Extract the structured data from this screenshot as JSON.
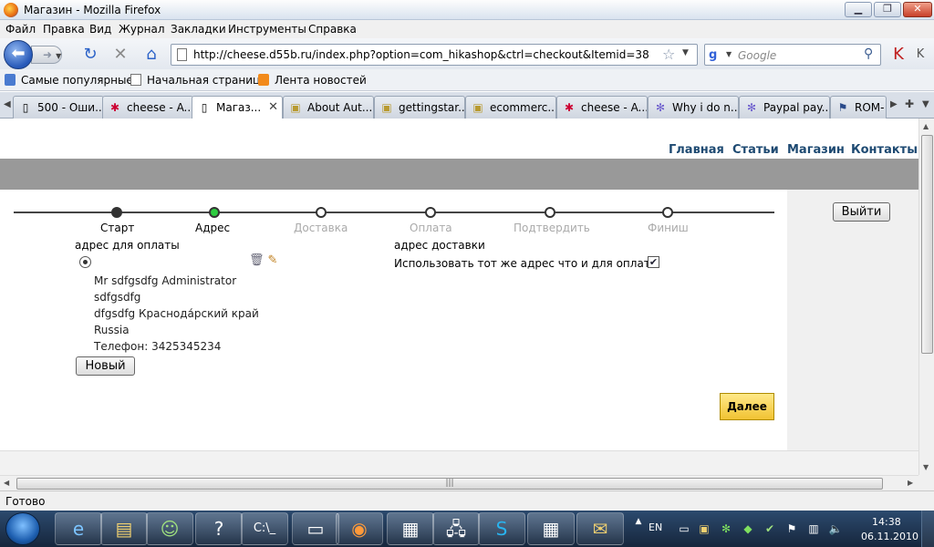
{
  "window": {
    "title": "Магазин - Mozilla Firefox",
    "minimize_icon": "minimize-icon",
    "maximize_icon": "restore-icon",
    "close_icon": "close-icon"
  },
  "menu": [
    "Файл",
    "Правка",
    "Вид",
    "Журнал",
    "Закладки",
    "Инструменты",
    "Справка"
  ],
  "nav": {
    "url": "http://cheese.d55b.ru/index.php?option=com_hikashop&ctrl=checkout&Itemid=38",
    "search_placeholder": "Google"
  },
  "bookmarks": [
    "Самые популярные",
    "Начальная страница",
    "Лента новостей"
  ],
  "tabs": [
    {
      "label": "500 - Оши...",
      "icon": "page-icon",
      "active": false
    },
    {
      "label": "cheese - A...",
      "icon": "joomla-icon",
      "active": false
    },
    {
      "label": "Магаз...",
      "icon": "page-icon",
      "active": true
    },
    {
      "label": "About Aut...",
      "icon": "folder-icon",
      "active": false
    },
    {
      "label": "gettingstar...",
      "icon": "folder-icon",
      "active": false
    },
    {
      "label": "ecommerc...",
      "icon": "folder-icon",
      "active": false
    },
    {
      "label": "cheese - A...",
      "icon": "joomla-icon",
      "active": false
    },
    {
      "label": "Why i do n...",
      "icon": "gear-icon",
      "active": false
    },
    {
      "label": "Paypal pay...",
      "icon": "gear-icon",
      "active": false
    },
    {
      "label": "ROM-",
      "icon": "flag-icon",
      "active": false
    }
  ],
  "site_nav": [
    "Главная",
    "Статьи",
    "Магазин",
    "Контакты"
  ],
  "checkout": {
    "steps": [
      {
        "label": "Старт",
        "state": "done"
      },
      {
        "label": "Адрес",
        "state": "current"
      },
      {
        "label": "Доставка",
        "state": "pending"
      },
      {
        "label": "Оплата",
        "state": "pending"
      },
      {
        "label": "Подтвердить",
        "state": "pending"
      },
      {
        "label": "Финиш",
        "state": "pending"
      }
    ],
    "billing_title": "адрес для оплаты",
    "shipping_title": "адрес доставки",
    "same_address_label": "Использовать тот же адрес что и для оплаты",
    "same_address_checked": true,
    "address_lines": [
      "Mr sdfgsdfg Administrator",
      "sdfgsdfg",
      "dfgsdfg Краснода́рский край",
      "Russia",
      "Телефон: 3425345234"
    ],
    "new_button": "Новый",
    "next_button": "Далее",
    "logout_button": "Выйти"
  },
  "status": "Готово",
  "taskbar": {
    "lang": "EN",
    "time": "14:38",
    "date": "06.11.2010"
  }
}
